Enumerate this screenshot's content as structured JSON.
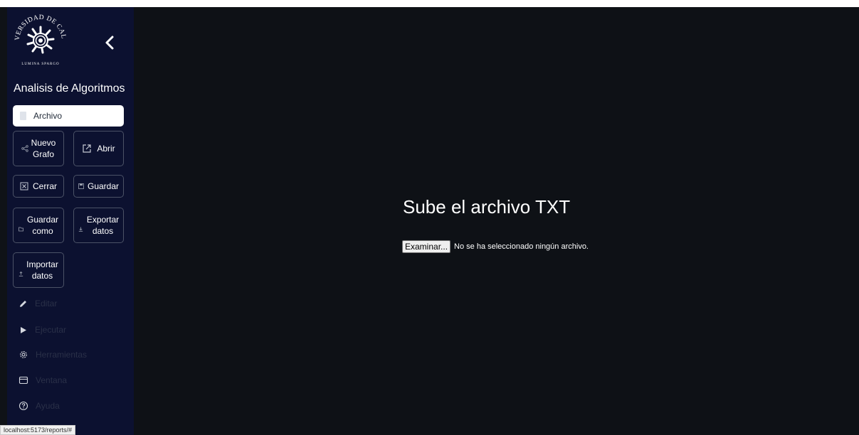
{
  "logo": {
    "arc_text": "UNIVERSIDAD DE CALDAS",
    "motto": "LUMINA SPARGO"
  },
  "sidebar": {
    "title": "Analisis de Algoritmos",
    "active_item": {
      "label": "Archivo",
      "icon": "file-icon"
    },
    "file_actions": [
      {
        "label": "Nuevo\nGrafo",
        "icon": "graph-share-icon"
      },
      {
        "label": "Abrir",
        "icon": "external-open-icon"
      },
      {
        "label": "Cerrar",
        "icon": "close-box-icon"
      },
      {
        "label": "Guardar",
        "icon": "save-icon"
      },
      {
        "label": "Guardar\ncomo",
        "icon": "save-as-icon"
      },
      {
        "label": "Exportar\ndatos",
        "icon": "download-icon"
      },
      {
        "label": "Importar\ndatos",
        "icon": "upload-icon"
      }
    ],
    "menu": [
      {
        "label": "Editar",
        "icon": "pencil-icon"
      },
      {
        "label": "Ejecutar",
        "icon": "play-icon"
      },
      {
        "label": "Herramientas",
        "icon": "gear-icon"
      },
      {
        "label": "Ventana",
        "icon": "window-icon"
      },
      {
        "label": "Ayuda",
        "icon": "help-icon"
      }
    ]
  },
  "main": {
    "heading": "Sube el archivo TXT",
    "browse_button": "Examinar...",
    "file_status": "No se ha seleccionado ningún archivo."
  },
  "status_url": "localhost:5173/reports/#"
}
